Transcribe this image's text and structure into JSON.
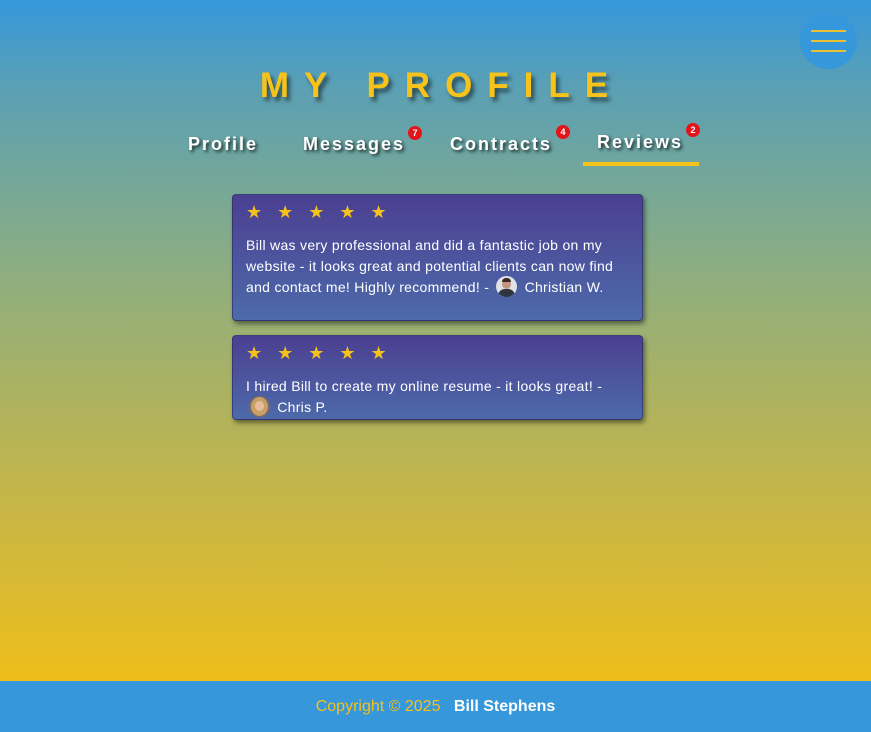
{
  "header": {
    "menu_icon": "hamburger-menu-icon",
    "title": "MY PROFILE"
  },
  "tabs": [
    {
      "label": "Profile",
      "badge": null,
      "active": false
    },
    {
      "label": "Messages",
      "badge": "7",
      "active": false
    },
    {
      "label": "Contracts",
      "badge": "4",
      "active": false
    },
    {
      "label": "Reviews",
      "badge": "2",
      "active": true
    }
  ],
  "reviews": [
    {
      "stars": "★ ★ ★ ★ ★",
      "text": "Bill was very professional and did a fantastic job on my website - it looks great and potential clients can now find and contact me! Highly recommend! -",
      "author": "Christian W.",
      "avatar_icon": "reviewer-avatar-man"
    },
    {
      "stars": "★ ★ ★ ★ ★",
      "text": "I hired Bill to create my online resume - it looks great! -",
      "author": "Chris P.",
      "avatar_icon": "reviewer-avatar-woman"
    }
  ],
  "footer": {
    "copyright": "Copyright © 2025",
    "author": "Bill Stephens"
  },
  "colors": {
    "accent": "#f5c11b",
    "header_blue": "#3697db",
    "badge_red": "#e4141b",
    "card_top": "#4b3f91",
    "card_bottom": "#4d6aaa"
  }
}
